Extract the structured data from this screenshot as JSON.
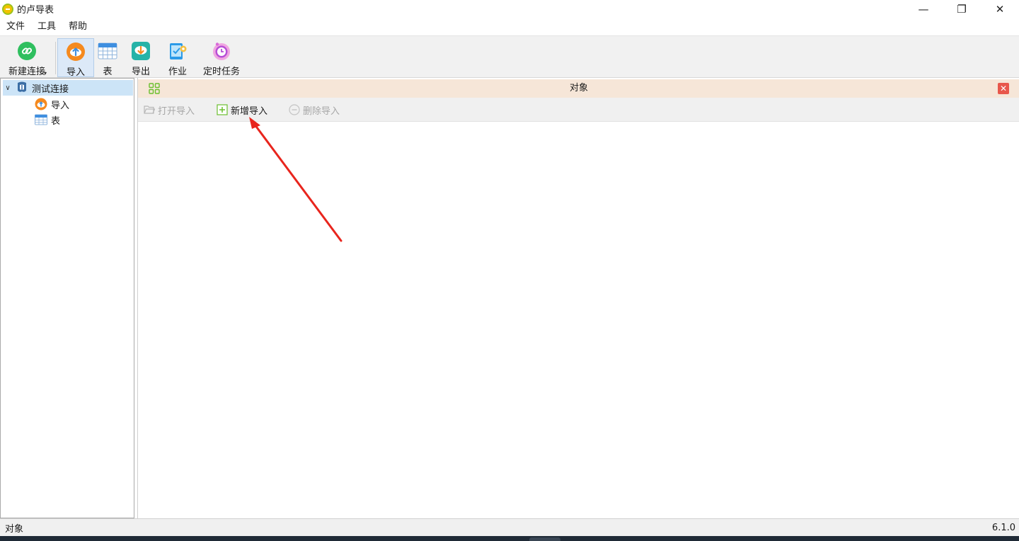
{
  "window": {
    "title": "的卢导表",
    "controls": {
      "minimize": "—",
      "maximize": "❐",
      "close": "✕"
    }
  },
  "menu": {
    "items": [
      {
        "label": "文件"
      },
      {
        "label": "工具"
      },
      {
        "label": "帮助"
      }
    ]
  },
  "toolbar": {
    "new_connection": "新建连接",
    "import": "导入",
    "table": "表",
    "export": "导出",
    "job": "作业",
    "scheduled_task": "定时任务",
    "active": "import"
  },
  "tree": {
    "connection": "测试连接",
    "children": [
      {
        "label": "导入",
        "icon": "import-icon"
      },
      {
        "label": "表",
        "icon": "table-icon"
      }
    ]
  },
  "tab": {
    "title": "对象"
  },
  "object_toolbar": {
    "open_import": "打开导入",
    "new_import": "新增导入",
    "delete_import": "删除导入"
  },
  "annotation": {
    "arrow_color": "#e8251d",
    "points_to": "new-import-button"
  },
  "status": {
    "left": "对象",
    "version": "6.1.0"
  },
  "colors": {
    "tab_header_bg": "#f6e6d8",
    "selected_bg": "#cce4f7",
    "toolbar_bg": "#f1f1f1",
    "disabled_text": "#a7a7a7"
  }
}
